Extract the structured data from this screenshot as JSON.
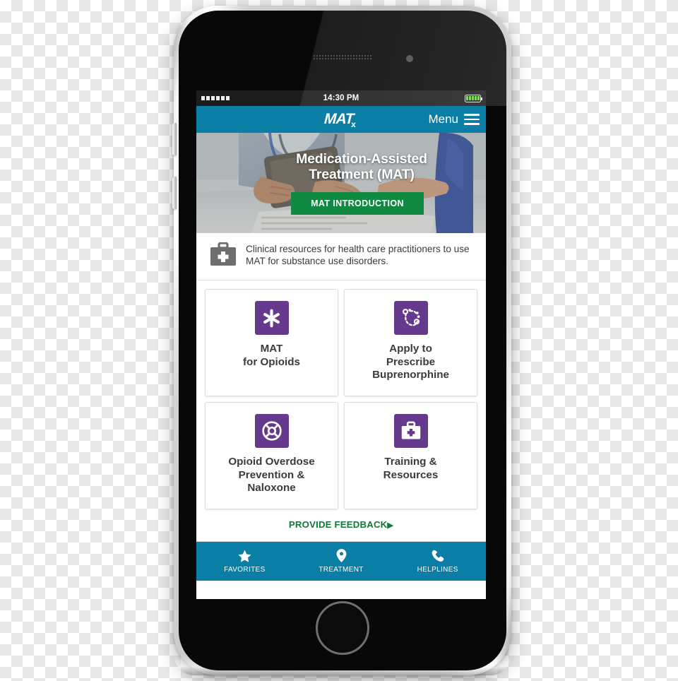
{
  "device": {
    "name": "smartphone-mockup",
    "home_button": "home-button",
    "volume_up": "volume-up-button",
    "volume_down": "volume-down-button"
  },
  "status_bar": {
    "signal_dots": 6,
    "time": "14:30 PM",
    "battery_bars": 5,
    "battery_icon": "battery-icon"
  },
  "header": {
    "logo_main": "MAT",
    "logo_sub": "x",
    "menu_label": "Menu",
    "menu_icon": "hamburger-menu-icon",
    "background_color": "#0a7ea4"
  },
  "hero": {
    "title": "Medication-Assisted\nTreatment (MAT)",
    "title_line1": "Medication-Assisted",
    "title_line2": "Treatment (MAT)",
    "button_label": "MAT INTRODUCTION",
    "button_color": "#108a43",
    "photo_description": "clinician-with-tablet-photo"
  },
  "description": {
    "icon": "medical-bag-icon",
    "text": "Clinical resources for health care practitioners to use MAT for substance use disorders."
  },
  "tiles": [
    {
      "id": "mat-for-opioids",
      "icon": "asterisk-icon",
      "label_line1": "MAT",
      "label_line2": "for Opioids",
      "label_line3": ""
    },
    {
      "id": "apply-to-prescribe-buprenorphine",
      "icon": "molecule-icon",
      "label_line1": "Apply to",
      "label_line2": "Prescribe",
      "label_line3": "Buprenorphine"
    },
    {
      "id": "opioid-overdose-prevention-naloxone",
      "icon": "life-ring-icon",
      "label_line1": "Opioid Overdose",
      "label_line2": "Prevention &",
      "label_line3": "Naloxone"
    },
    {
      "id": "training-and-resources",
      "icon": "medical-bag-icon",
      "label_line1": "Training &",
      "label_line2": "Resources",
      "label_line3": ""
    }
  ],
  "feedback": {
    "label": "PROVIDE FEEDBACK",
    "caret": "▶",
    "color": "#13763b"
  },
  "tab_bar": {
    "background_color": "#0a7ea4",
    "items": [
      {
        "id": "favorites",
        "icon": "star-icon",
        "label": "FAVORITES"
      },
      {
        "id": "treatment",
        "icon": "location-pin-icon",
        "label": "TREATMENT"
      },
      {
        "id": "helplines",
        "icon": "phone-icon",
        "label": "HELPLINES"
      }
    ]
  },
  "colors": {
    "brand_teal": "#0a7ea4",
    "brand_purple": "#653a8c",
    "brand_green": "#108a43",
    "feedback_green": "#13763b"
  }
}
